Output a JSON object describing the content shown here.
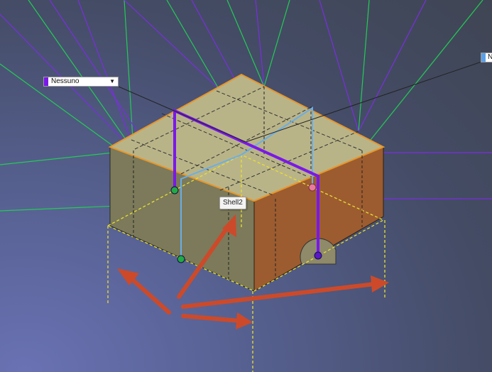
{
  "viewport": {
    "colors": {
      "top_face": "#b9b488",
      "left_face": "#7c7a5a",
      "right_face": "#9c5c30",
      "edge_orange": "#e8962a",
      "edge_yellow": "#e8e030",
      "pipe_purple": "#7a18e8",
      "pipe_blue": "#6aaee8",
      "ray_green": "#22cc55",
      "ray_violet": "#7b2ee0",
      "arrow_red": "#cc4a2a"
    }
  },
  "widgets": {
    "dropdown_main": {
      "label": "Nessuno",
      "color": "#7a18e8"
    },
    "dropdown_edge": {
      "label": "N",
      "color": "#5aa0e8"
    },
    "shell_tag": {
      "label": "Shell2"
    }
  }
}
